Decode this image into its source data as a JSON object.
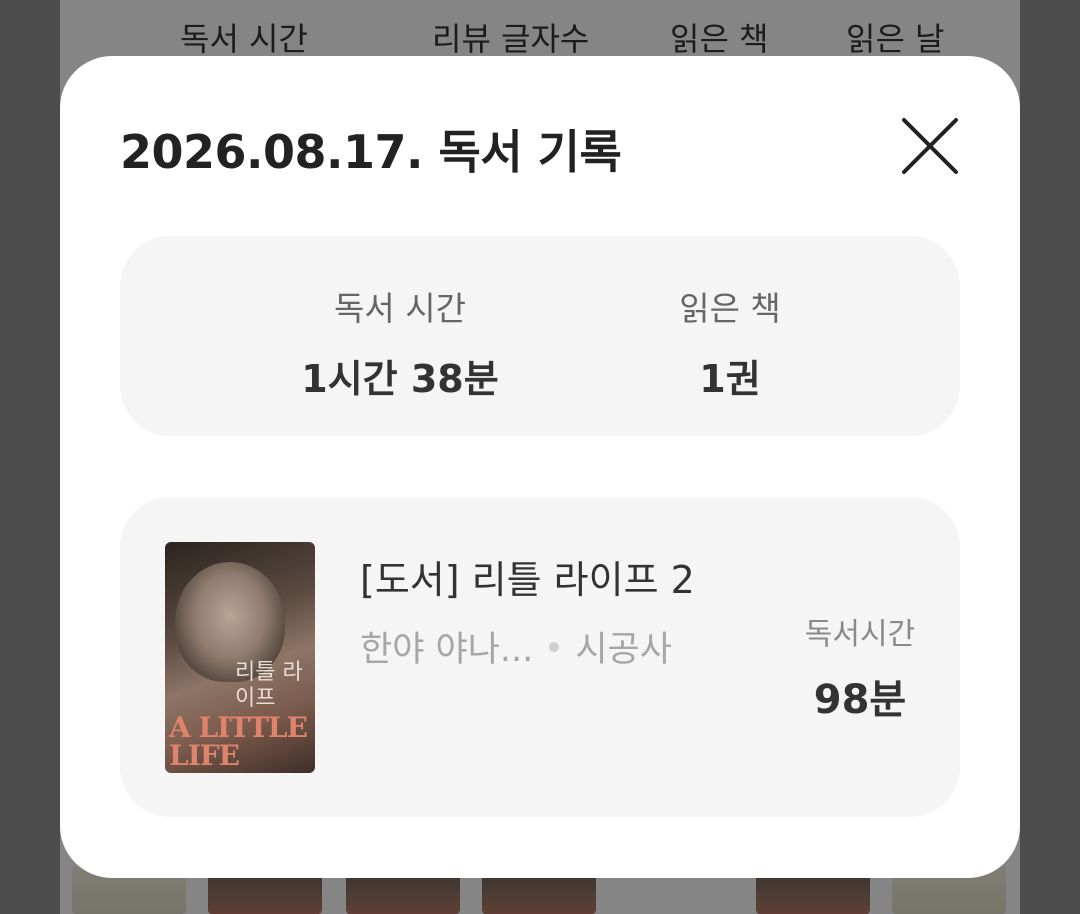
{
  "background": {
    "tabs": [
      "독서 시간",
      "리뷰 글자수",
      "읽은 책",
      "읽은 날"
    ]
  },
  "modal": {
    "title": "2026.08.17. 독서 기록",
    "close_icon": "close-icon",
    "summary": {
      "reading_time_label": "독서 시간",
      "reading_time_value": "1시간 38분",
      "books_read_label": "읽은 책",
      "books_read_value": "1권"
    },
    "book": {
      "cover_title_kr": "리틀 라이프",
      "cover_title_en": "A LITTLE LIFE",
      "title": "[도서] 리틀 라이프 2",
      "author": "한야 야나...",
      "publisher": "시공사",
      "time_label": "독서시간",
      "time_value": "98분"
    }
  },
  "colors": {
    "overlay": "#8a8a8a",
    "modal_bg": "#ffffff",
    "card_bg": "#f5f5f5",
    "text_dark": "#333333",
    "text_muted": "#a6a6a6"
  }
}
